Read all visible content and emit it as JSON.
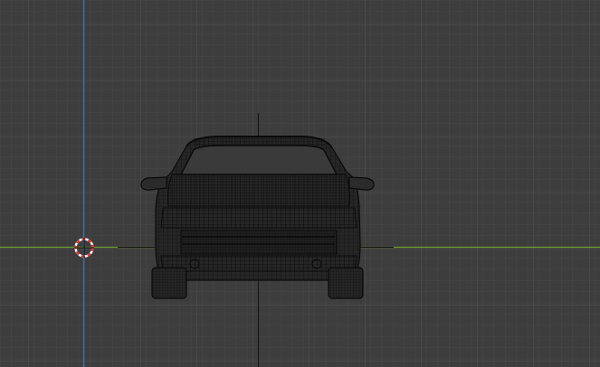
{
  "viewport": {
    "background": "#3d3d3d",
    "minor_grid_color": "#474747",
    "major_grid_color": "#525252",
    "x_axis_color": "#6f9e2e",
    "y_axis_color": "#3f6fb0",
    "mesh_color": "#0a0a0a",
    "mesh_fill": "#262626",
    "cursor_outer_color": "#d63a3a",
    "cursor_inner_color": "#ffffff"
  },
  "scene": {
    "object": "car-wireframe-front-view",
    "shading": "wireframe"
  }
}
